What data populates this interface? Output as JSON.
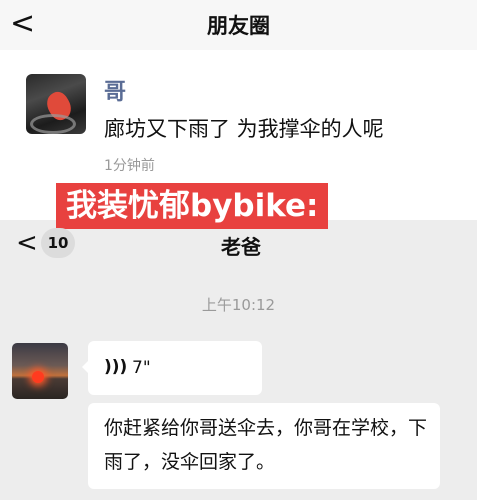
{
  "moments": {
    "title": "朋友圈",
    "back_glyph": "<",
    "post": {
      "author": "哥",
      "text": "廊坊又下雨了 为我撑伞的人呢",
      "time": "1分钟前"
    }
  },
  "caption": {
    "text": "我装忧郁bybike:",
    "color": "#e8413f"
  },
  "chat": {
    "back_glyph": "<",
    "unread_count": "10",
    "title": "老爸",
    "timestamp": "上午10:12",
    "messages": [
      {
        "type": "voice",
        "icon": "voice-wave-icon",
        "duration": "7\""
      },
      {
        "type": "text",
        "text": "你赶紧给你哥送伞去，你哥在学校，下雨了，没伞回家了。"
      }
    ]
  }
}
